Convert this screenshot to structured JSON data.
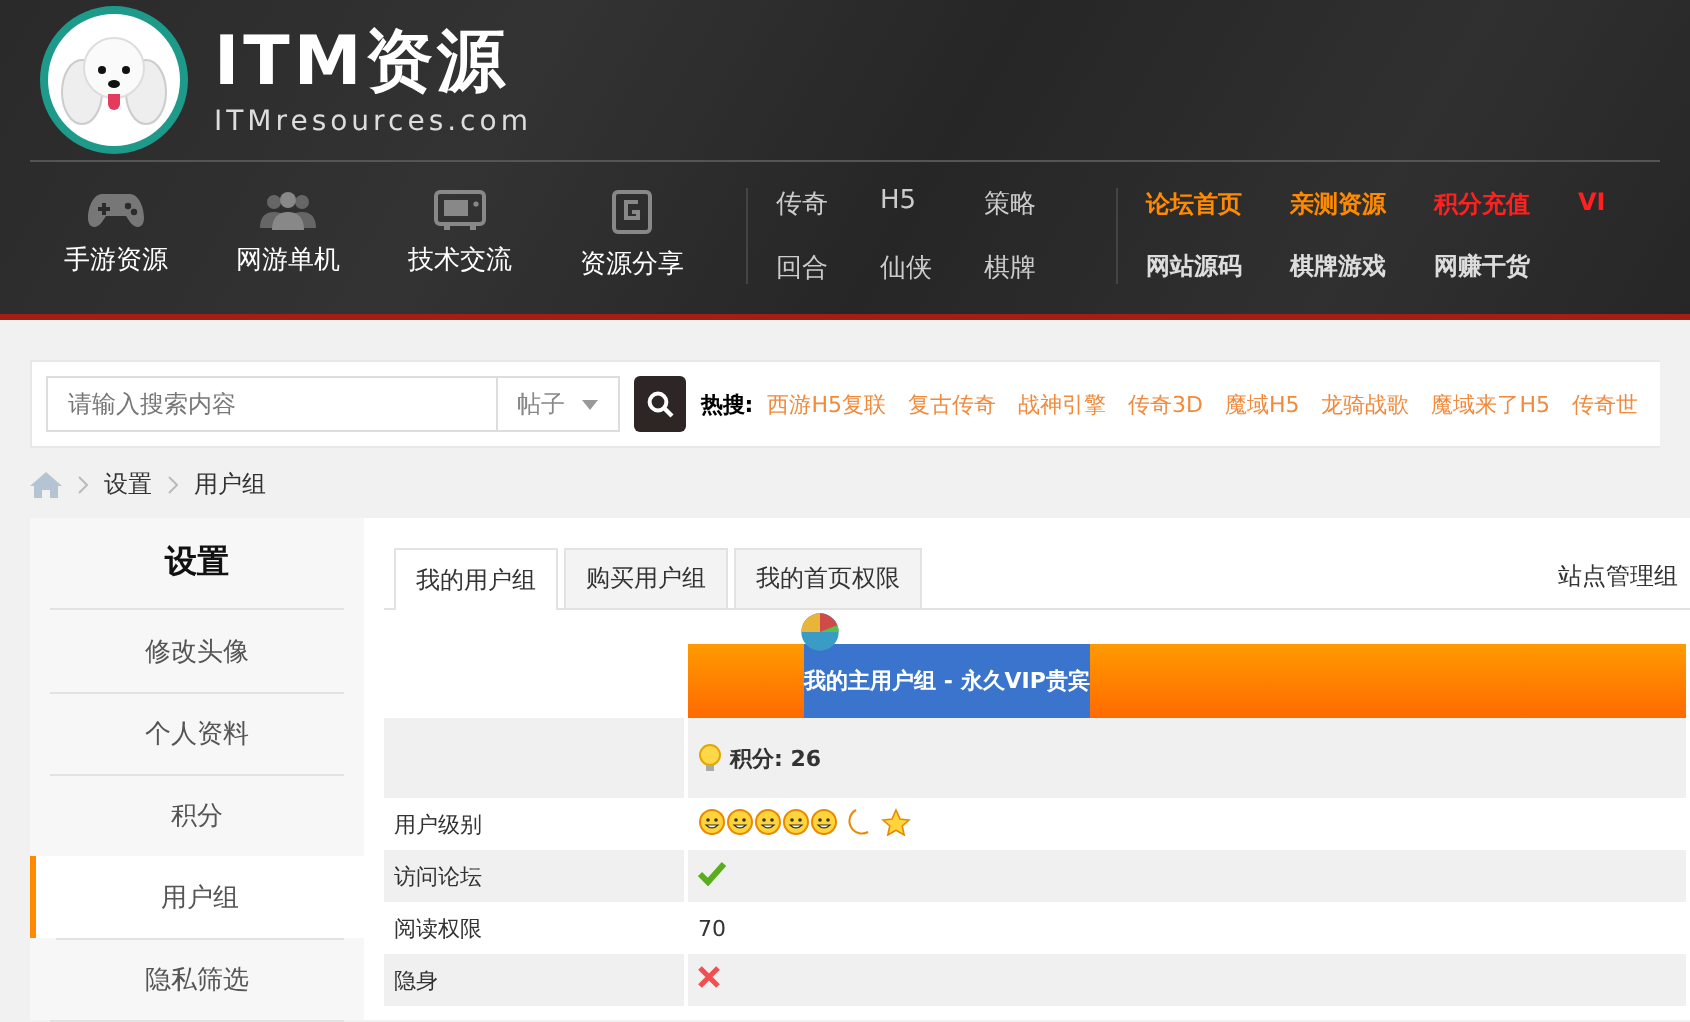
{
  "logo": {
    "title": "ITM资源",
    "subtitle": "ITMresources.com"
  },
  "main_nav": [
    {
      "label": "手游资源",
      "kind": "gamepad"
    },
    {
      "label": "网游单机",
      "kind": "people"
    },
    {
      "label": "技术交流",
      "kind": "tv"
    },
    {
      "label": "资源分享",
      "kind": "tablet"
    }
  ],
  "category_links": [
    [
      "传奇",
      "H5",
      "策略"
    ],
    [
      "回合",
      "仙侠",
      "棋牌"
    ]
  ],
  "feature_links": [
    [
      {
        "label": "论坛首页",
        "color": "#ff8a00"
      },
      {
        "label": "亲测资源",
        "color": "#ff8a00"
      },
      {
        "label": "积分充值",
        "color": "#ff2020"
      },
      {
        "label": "VI",
        "color": "#ff2020"
      }
    ],
    [
      {
        "label": "网站源码",
        "color": "#dddddd"
      },
      {
        "label": "棋牌游戏",
        "color": "#dddddd"
      },
      {
        "label": "网赚干货",
        "color": "#dddddd"
      }
    ]
  ],
  "search": {
    "placeholder": "请输入搜索内容",
    "scope": "帖子"
  },
  "hot_search": {
    "label": "热搜:",
    "items": [
      "西游H5复联",
      "复古传奇",
      "战神引擎",
      "传奇3D",
      "魔域H5",
      "龙骑战歌",
      "魔域来了H5",
      "传奇世"
    ]
  },
  "breadcrumb": [
    "设置",
    "用户组"
  ],
  "sidebar": {
    "title": "设置",
    "items": [
      {
        "label": "修改头像",
        "selected": false
      },
      {
        "label": "个人资料",
        "selected": false
      },
      {
        "label": "积分",
        "selected": false
      },
      {
        "label": "用户组",
        "selected": true
      },
      {
        "label": "隐私筛选",
        "selected": false
      }
    ]
  },
  "tabs": [
    {
      "label": "我的用户组",
      "selected": true
    },
    {
      "label": "购买用户组",
      "selected": false
    },
    {
      "label": "我的首页权限",
      "selected": false
    }
  ],
  "tabs_right": "站点管理组",
  "group_header": "我的主用户组 - 永久VIP贵宾",
  "points": "积分: 26",
  "rows": [
    {
      "label": "用户级别",
      "kind": "level"
    },
    {
      "label": "访问论坛",
      "kind": "check"
    },
    {
      "label": "阅读权限",
      "kind": "text",
      "value": "70"
    },
    {
      "label": "隐身",
      "kind": "cross"
    }
  ]
}
